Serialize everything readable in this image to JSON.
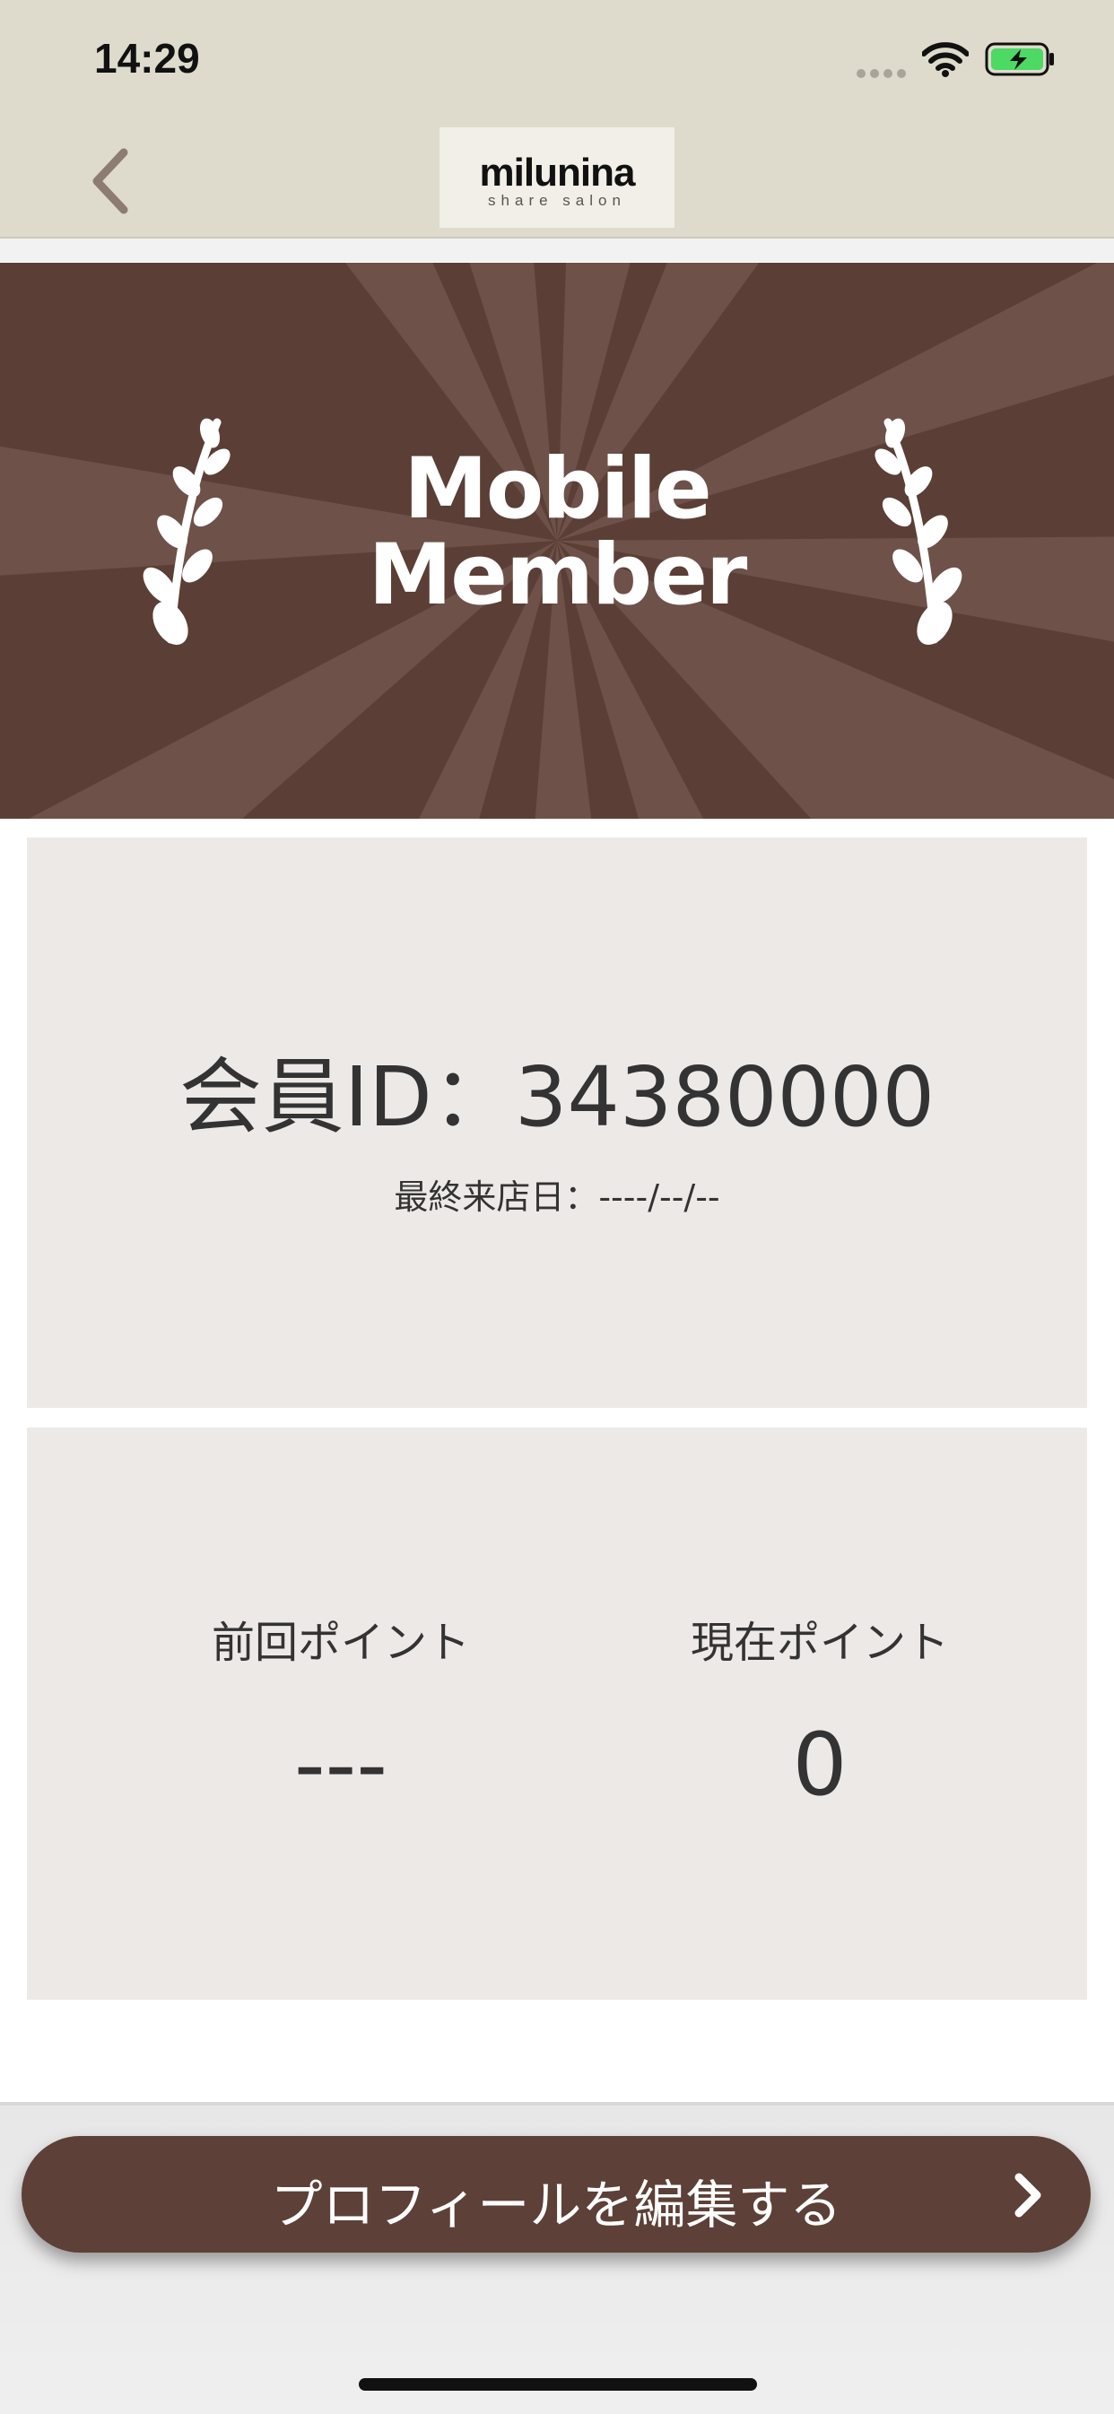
{
  "status_bar": {
    "time": "14:29"
  },
  "nav": {
    "logo_main": "milunina",
    "logo_sub": "share salon"
  },
  "banner": {
    "line1": "Mobile",
    "line2": "Member"
  },
  "member": {
    "id_text": "会員ID：34380000",
    "last_visit": "最終来店日：----/--/--"
  },
  "points": {
    "previous_label": "前回ポイント",
    "previous_value": "---",
    "current_label": "現在ポイント",
    "current_value": "0"
  },
  "footer": {
    "edit_profile_label": "プロフィールを編集する"
  },
  "colors": {
    "brand_brown": "#5d4037",
    "header_beige": "#dedbcc",
    "card_bg": "#ede9e6",
    "battery_green": "#4cd964"
  }
}
